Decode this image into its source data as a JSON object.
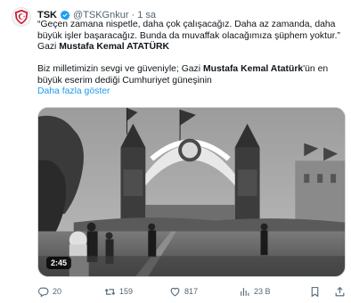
{
  "author": {
    "name": "TSK",
    "handle": "@TSKGnkur",
    "separator": "·",
    "time": "1 sa",
    "avatar_icon": "tsk-emblem-icon",
    "verified_icon": "verified-badge-icon"
  },
  "tweet": {
    "quote_line1": "“Geçen zamana nispetle, daha çok çalışacağız. Daha az zamanda, daha",
    "quote_line2": "büyük işler başaracağız. Bunda da muvaffak olacağımıza şüphem yoktur.”",
    "sig_prefix": "Gazi ",
    "sig_name": "Mustafa Kemal ATATÜRK",
    "para_prefix": "Biz milletimizin sevgi ve güveniyle; Gazi ",
    "para_name": "Mustafa Kemal Atatürk",
    "para_suffix": "'ün en büyük eserim dediği Cumhuriyet güneşinin",
    "show_more": "Daha fazla göster"
  },
  "media": {
    "type": "video",
    "duration": "2:45"
  },
  "actions": {
    "replies": "20",
    "reposts": "159",
    "likes": "817",
    "views": "23 B"
  },
  "colors": {
    "link": "#1d9bf0",
    "muted": "#536471",
    "text": "#0f1419"
  }
}
